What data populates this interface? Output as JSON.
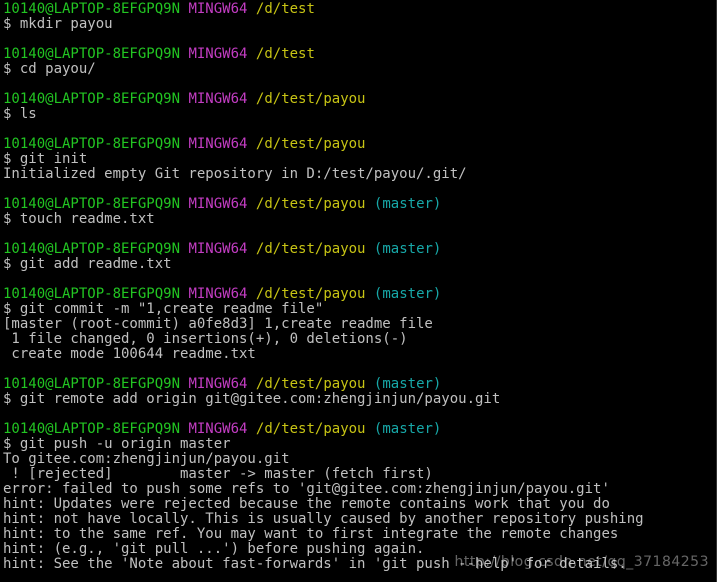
{
  "terminal": {
    "colors": {
      "background": "#000000",
      "text": "#c0c0c0",
      "user": "#22c522",
      "system": "#c33dc3",
      "path": "#c7c414",
      "branch": "#17a8a8"
    },
    "blocks": [
      {
        "prompt": {
          "user": "10140@LAPTOP-8EFGPQ9N",
          "system": "MINGW64",
          "path": "/d/test",
          "branch": ""
        },
        "command": "$ mkdir payou",
        "output": []
      },
      {
        "prompt": {
          "user": "10140@LAPTOP-8EFGPQ9N",
          "system": "MINGW64",
          "path": "/d/test",
          "branch": ""
        },
        "command": "$ cd payou/",
        "output": []
      },
      {
        "prompt": {
          "user": "10140@LAPTOP-8EFGPQ9N",
          "system": "MINGW64",
          "path": "/d/test/payou",
          "branch": ""
        },
        "command": "$ ls",
        "output": []
      },
      {
        "prompt": {
          "user": "10140@LAPTOP-8EFGPQ9N",
          "system": "MINGW64",
          "path": "/d/test/payou",
          "branch": ""
        },
        "command": "$ git init",
        "output": [
          "Initialized empty Git repository in D:/test/payou/.git/"
        ]
      },
      {
        "prompt": {
          "user": "10140@LAPTOP-8EFGPQ9N",
          "system": "MINGW64",
          "path": "/d/test/payou",
          "branch": "(master)"
        },
        "command": "$ touch readme.txt",
        "output": []
      },
      {
        "prompt": {
          "user": "10140@LAPTOP-8EFGPQ9N",
          "system": "MINGW64",
          "path": "/d/test/payou",
          "branch": "(master)"
        },
        "command": "$ git add readme.txt",
        "output": []
      },
      {
        "prompt": {
          "user": "10140@LAPTOP-8EFGPQ9N",
          "system": "MINGW64",
          "path": "/d/test/payou",
          "branch": "(master)"
        },
        "command": "$ git commit -m \"1,create readme file\"",
        "output": [
          "[master (root-commit) a0fe8d3] 1,create readme file",
          " 1 file changed, 0 insertions(+), 0 deletions(-)",
          " create mode 100644 readme.txt"
        ]
      },
      {
        "prompt": {
          "user": "10140@LAPTOP-8EFGPQ9N",
          "system": "MINGW64",
          "path": "/d/test/payou",
          "branch": "(master)"
        },
        "command": "$ git remote add origin git@gitee.com:zhengjinjun/payou.git",
        "output": []
      },
      {
        "prompt": {
          "user": "10140@LAPTOP-8EFGPQ9N",
          "system": "MINGW64",
          "path": "/d/test/payou",
          "branch": "(master)"
        },
        "command": "$ git push -u origin master",
        "output": [
          "To gitee.com:zhengjinjun/payou.git",
          " ! [rejected]        master -> master (fetch first)",
          "error: failed to push some refs to 'git@gitee.com:zhengjinjun/payou.git'",
          "hint: Updates were rejected because the remote contains work that you do",
          "hint: not have locally. This is usually caused by another repository pushing",
          "hint: to the same ref. You may want to first integrate the remote changes",
          "hint: (e.g., 'git pull ...') before pushing again.",
          "hint: See the 'Note about fast-forwards' in 'git push --help' for details."
        ]
      }
    ]
  },
  "watermark": "http://blog.csdn.net/qq_37184253"
}
